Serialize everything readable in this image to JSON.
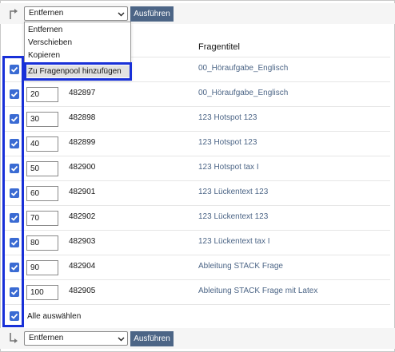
{
  "colors": {
    "accent": "#4c6586",
    "checkbox": "#3a6bd3",
    "highlight": "#1830d8"
  },
  "toolbar_top": {
    "action_value": "Entfernen",
    "execute_label": "Ausführen"
  },
  "dropdown": {
    "options": [
      "Entfernen",
      "Verschieben",
      "Kopieren",
      "Zu Fragenpool hinzufügen"
    ]
  },
  "table": {
    "header_title": "Fragentitel",
    "rows": [
      {
        "checked": true,
        "position": "",
        "id": "",
        "title": "00_Höraufgabe_Englisch"
      },
      {
        "checked": true,
        "position": "20",
        "id": "482897",
        "title": "00_Höraufgabe_Englisch"
      },
      {
        "checked": true,
        "position": "30",
        "id": "482898",
        "title": "123 Hotspot 123"
      },
      {
        "checked": true,
        "position": "40",
        "id": "482899",
        "title": "123 Hotspot 123"
      },
      {
        "checked": true,
        "position": "50",
        "id": "482900",
        "title": "123 Hotspot tax I"
      },
      {
        "checked": true,
        "position": "60",
        "id": "482901",
        "title": "123 Lückentext 123"
      },
      {
        "checked": true,
        "position": "70",
        "id": "482902",
        "title": "123 Lückentext 123"
      },
      {
        "checked": true,
        "position": "80",
        "id": "482903",
        "title": "123 Lückentext tax I"
      },
      {
        "checked": true,
        "position": "90",
        "id": "482904",
        "title": "Ableitung STACK Frage"
      },
      {
        "checked": true,
        "position": "100",
        "id": "482905",
        "title": "Ableitung STACK Frage mit Latex"
      }
    ],
    "select_all_label": "Alle auswählen"
  },
  "toolbar_bottom": {
    "action_value": "Entfernen",
    "execute_label": "Ausführen"
  }
}
